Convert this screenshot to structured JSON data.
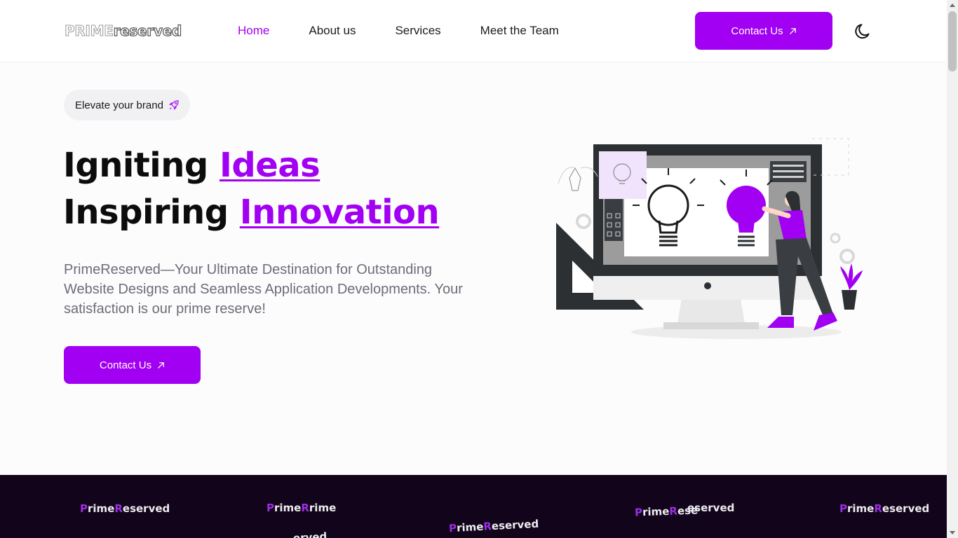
{
  "header": {
    "logo_part1": "PRIME",
    "logo_part2": "reserved",
    "nav": [
      {
        "label": "Home",
        "active": true
      },
      {
        "label": "About us",
        "active": false
      },
      {
        "label": "Services",
        "active": false
      },
      {
        "label": "Meet the Team",
        "active": false
      }
    ],
    "contact_label": "Contact Us",
    "theme_icon": "moon-icon"
  },
  "hero": {
    "badge_label": "Elevate your brand",
    "badge_icon": "rocket-icon",
    "line1_plain": "Igniting ",
    "line1_accent": "Ideas",
    "line2_plain": "Inspiring ",
    "line2_accent": "Innovation",
    "description": "PrimeReserved—Your Ultimate Destination for Outstanding Website Designs and Seamless Application Developments. Your satisfaction is our prime reserve!",
    "contact_label": "Contact Us"
  },
  "band": {
    "logo_first_letter_1": "P",
    "logo_mid_1": "rime",
    "logo_first_letter_2": "R",
    "logo_mid_2": "eserved",
    "logo_partial_1": "rime",
    "logo_partial_2": "ese",
    "logo_partial_3": "serv",
    "logo_partial_4": "erved",
    "logo_overlay": "eserved"
  },
  "colors": {
    "accent": "#a100f2",
    "band_background": "#12041a",
    "text_muted": "#6d6d78"
  }
}
